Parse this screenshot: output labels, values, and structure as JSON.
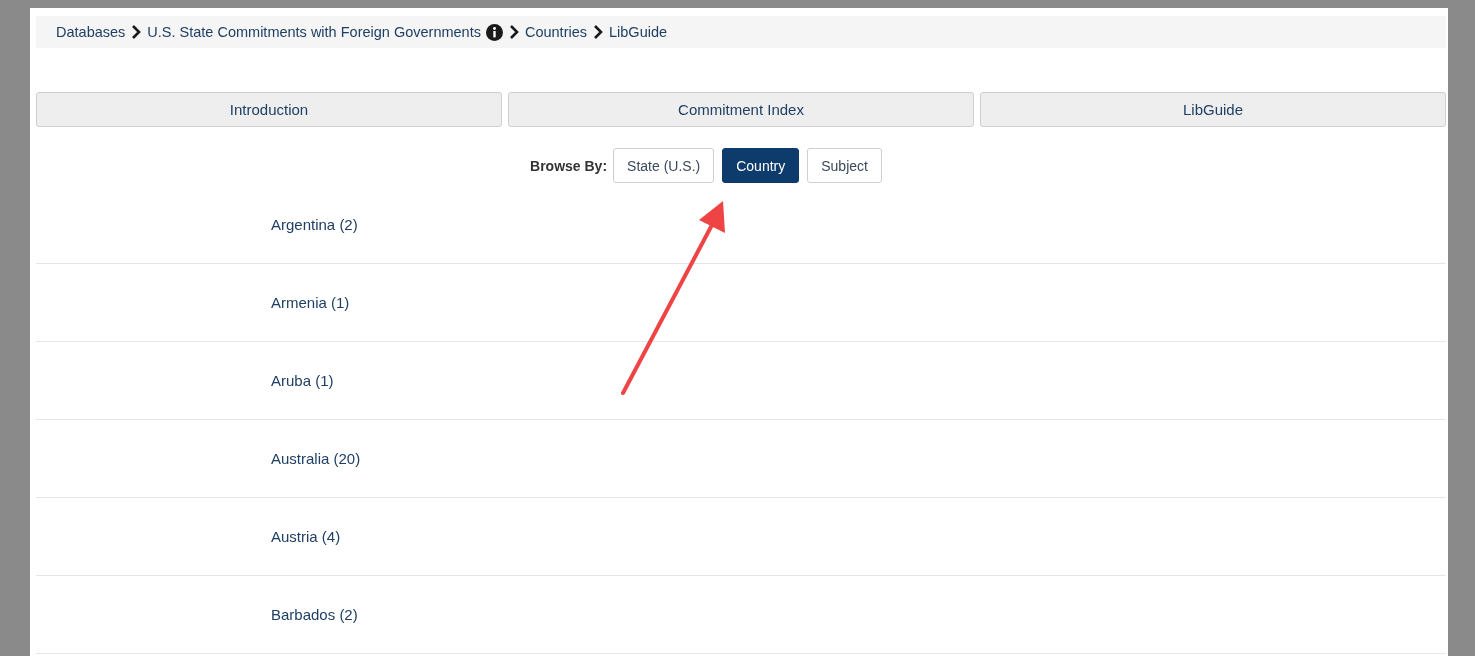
{
  "breadcrumb": [
    {
      "label": "Databases",
      "info": false
    },
    {
      "label": "U.S. State Commitments with Foreign Governments",
      "info": true
    },
    {
      "label": "Countries",
      "info": false
    },
    {
      "label": "LibGuide",
      "info": false
    }
  ],
  "tabs": [
    {
      "label": "Introduction"
    },
    {
      "label": "Commitment Index"
    },
    {
      "label": "LibGuide"
    }
  ],
  "browse": {
    "label": "Browse By:",
    "options": [
      {
        "label": "State (U.S.)",
        "selected": false
      },
      {
        "label": "Country",
        "selected": true
      },
      {
        "label": "Subject",
        "selected": false
      }
    ]
  },
  "countries": [
    "Argentina (2)",
    "Armenia (1)",
    "Aruba (1)",
    "Australia (20)",
    "Austria (4)",
    "Barbados (2)"
  ]
}
